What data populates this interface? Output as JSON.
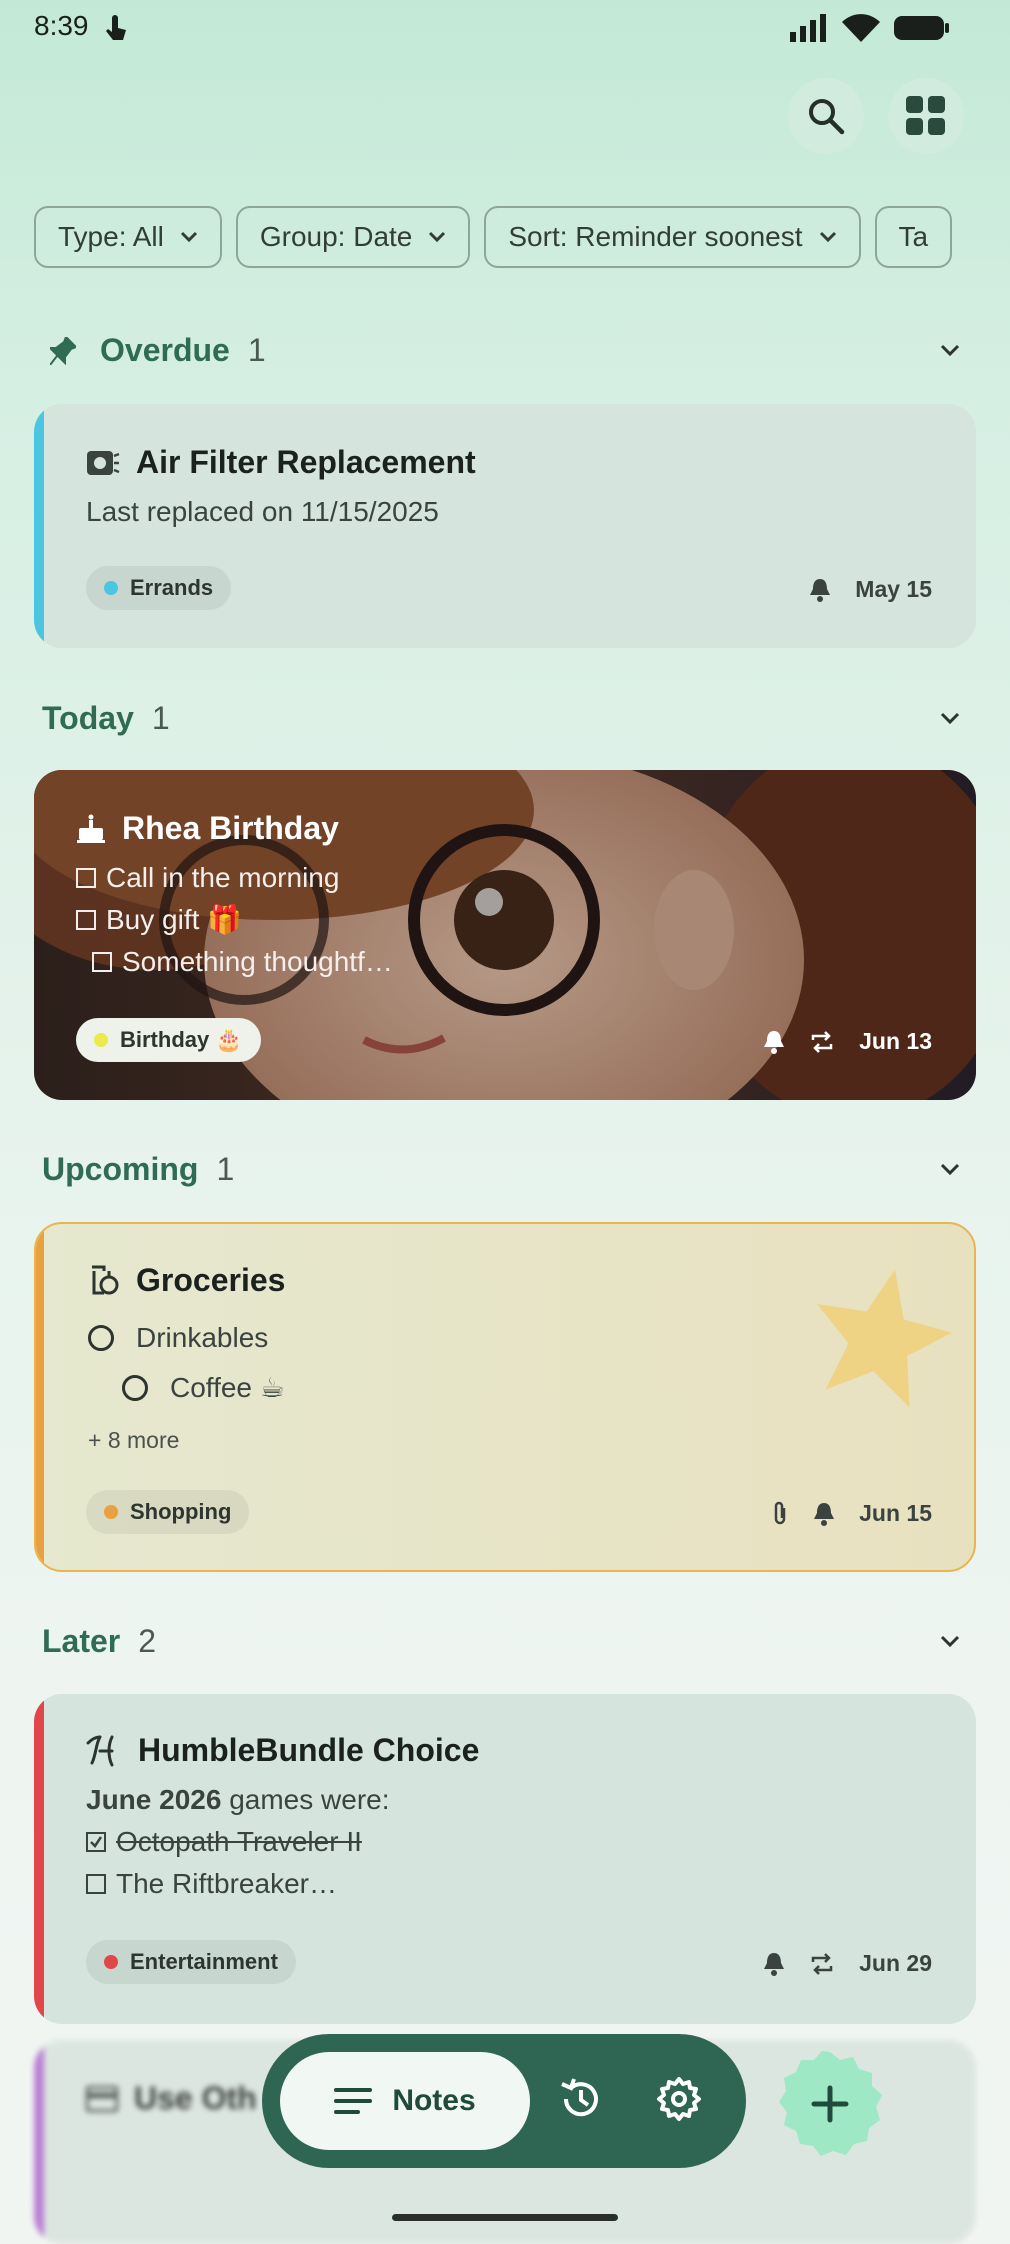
{
  "status": {
    "time": "8:39"
  },
  "filters": [
    {
      "label": "Type: All"
    },
    {
      "label": "Group: Date"
    },
    {
      "label": "Sort: Reminder soonest"
    },
    {
      "label": "Ta"
    }
  ],
  "sections": {
    "overdue": {
      "title": "Overdue",
      "count": "1"
    },
    "today": {
      "title": "Today",
      "count": "1"
    },
    "upcoming": {
      "title": "Upcoming",
      "count": "1"
    },
    "later": {
      "title": "Later",
      "count": "2"
    }
  },
  "cards": {
    "air_filter": {
      "title": "Air Filter Replacement",
      "body": "Last replaced on 11/15/2025",
      "tag": "Errands",
      "date": "May 15",
      "accent": "#4cc6e0"
    },
    "rhea": {
      "title": "Rhea Birthday",
      "items": [
        "Call in the morning",
        "Buy gift 🎁",
        "Something thoughtf…"
      ],
      "tag": "Birthday 🎂",
      "date": "Jun 13"
    },
    "groceries": {
      "title": "Groceries",
      "items": [
        "Drinkables",
        "Coffee ☕"
      ],
      "more": "+ 8 more",
      "tag": "Shopping",
      "date": "Jun 15",
      "accent": "#e8a13e"
    },
    "humble": {
      "title": "HumbleBundle Choice",
      "body_bold": "June 2026",
      "body_rest": " games were:",
      "items": [
        "Octopath Traveler II",
        "The Riftbreaker…"
      ],
      "tag": "Entertainment",
      "date": "Jun 29",
      "accent": "#e0464a"
    },
    "partial": {
      "title": "Use Oth"
    }
  },
  "nav": {
    "notes_label": "Notes"
  },
  "icons": [
    "search-icon",
    "grid-icon",
    "chevron-down-icon",
    "pin-icon",
    "bell-icon",
    "repeat-icon",
    "attachment-icon",
    "history-icon",
    "settings-icon",
    "add-icon",
    "menu-icon"
  ]
}
